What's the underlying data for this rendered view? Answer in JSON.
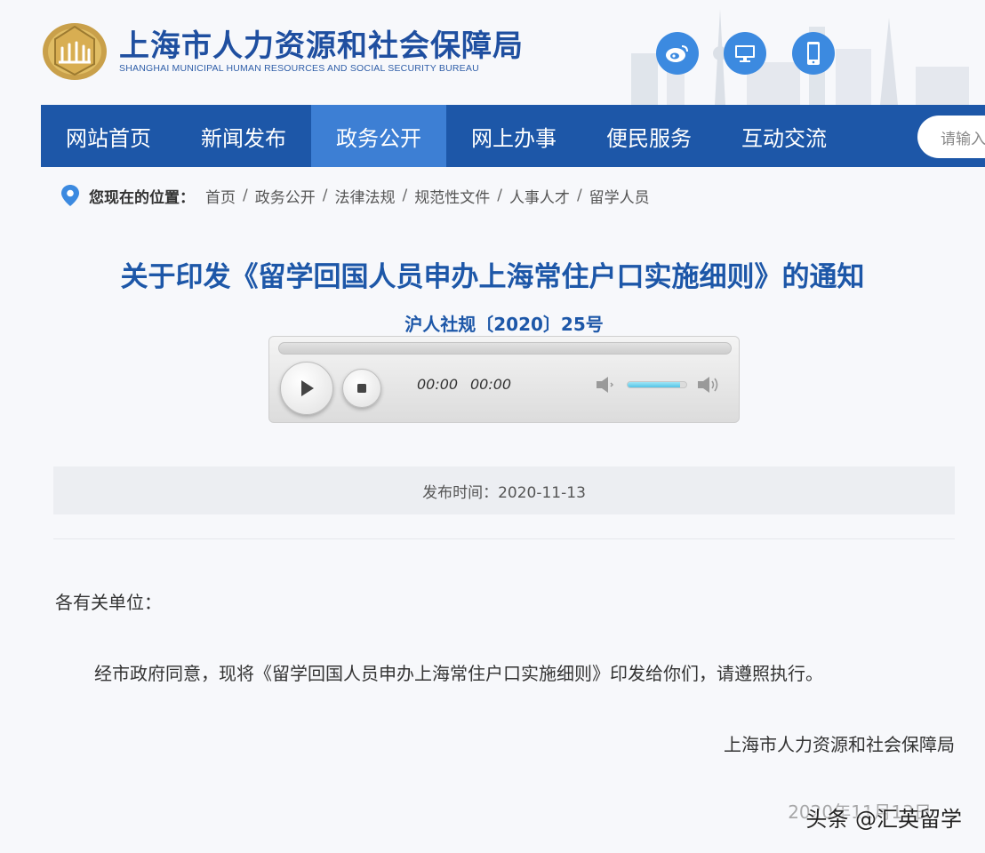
{
  "header": {
    "site_title": "上海市人力资源和社会保障局",
    "site_subtitle": "SHANGHAI MUNICIPAL HUMAN RESOURCES AND SOCIAL SECURITY BUREAU",
    "icons": [
      "weibo-icon",
      "desktop-icon",
      "mobile-icon"
    ]
  },
  "nav": {
    "items": [
      {
        "label": "网站首页",
        "active": false
      },
      {
        "label": "新闻发布",
        "active": false
      },
      {
        "label": "政务公开",
        "active": true
      },
      {
        "label": "网上办事",
        "active": false
      },
      {
        "label": "便民服务",
        "active": false
      },
      {
        "label": "互动交流",
        "active": false
      }
    ],
    "search_placeholder": "请输入"
  },
  "breadcrumb": {
    "label": "您现在的位置：",
    "items": [
      "首页",
      "政务公开",
      "法律法规",
      "规范性文件",
      "人事人才",
      "留学人员"
    ]
  },
  "document": {
    "title": "关于印发《留学回国人员申办上海常住户口实施细则》的通知",
    "number": "沪人社规〔2020〕25号",
    "publish_label": "发布时间：2020-11-13",
    "salutation": "各有关单位：",
    "body": "经市政府同意，现将《留学回国人员申办上海常住户口实施细则》印发给你们，请遵照执行。",
    "signature": "上海市人力资源和社会保障局",
    "sign_date": "2020年11月13日"
  },
  "player": {
    "current_time": "00:00",
    "duration": "00:00",
    "progress": 0,
    "volume": 0.9
  },
  "watermark": "头条 @汇英留学",
  "colors": {
    "brand_blue": "#1d57a8",
    "nav_active": "#3d7fd4",
    "title_blue": "#1d57a8",
    "icon_blue": "#3c8ae0"
  }
}
